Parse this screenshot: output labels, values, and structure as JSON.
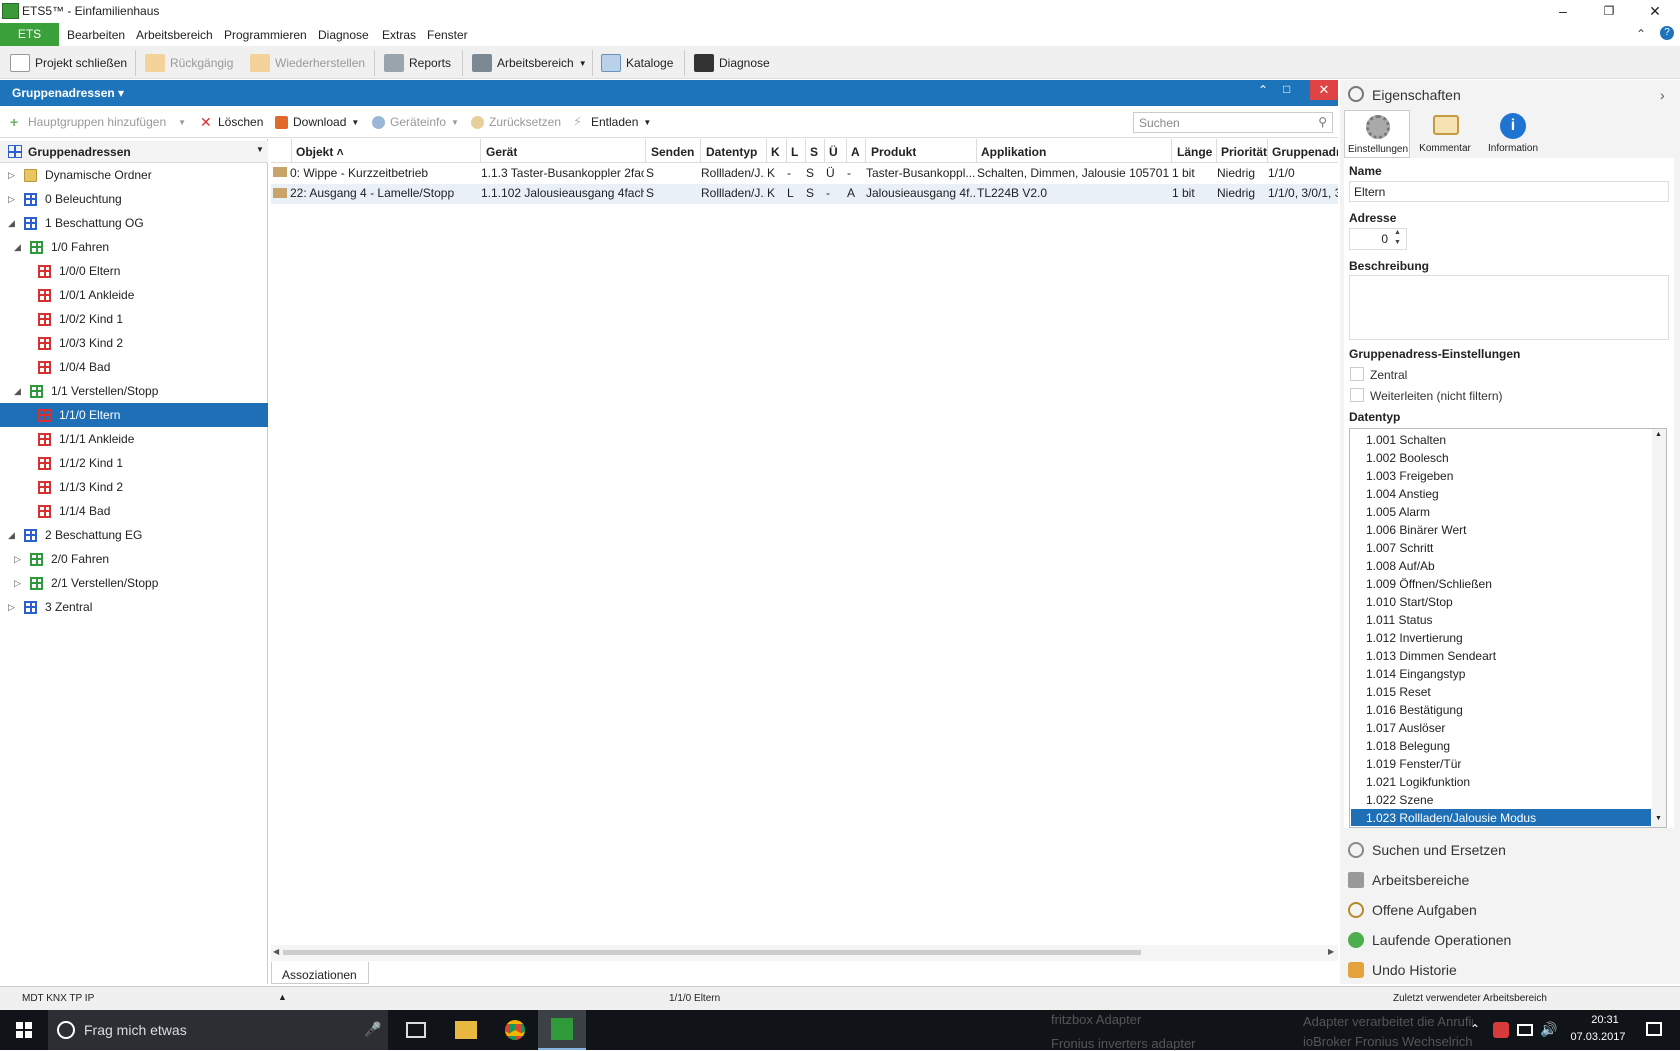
{
  "window": {
    "title": "ETS5™ - Einfamilienhaus"
  },
  "menu": {
    "ets": "ETS",
    "items": [
      "Bearbeiten",
      "Arbeitsbereich",
      "Programmieren",
      "Diagnose",
      "Extras",
      "Fenster"
    ]
  },
  "toolbar": {
    "close_project": "Projekt schließen",
    "undo": "Rückgängig",
    "redo": "Wiederherstellen",
    "reports": "Reports",
    "workspace": "Arbeitsbereich",
    "catalogs": "Kataloge",
    "diagnose": "Diagnose"
  },
  "panel": {
    "title": "Gruppenadressen"
  },
  "toolbar2": {
    "add_main": "Hauptgruppen hinzufügen",
    "delete": "Löschen",
    "download": "Download",
    "device_info": "Geräteinfo",
    "reset": "Zurücksetzen",
    "unload": "Entladen",
    "search_placeholder": "Suchen"
  },
  "tree": {
    "header": "Gruppenadressen",
    "items": [
      {
        "label": "Dynamische Ordner"
      },
      {
        "label": "0 Beleuchtung"
      },
      {
        "label": "1 Beschattung OG"
      },
      {
        "label": "1/0 Fahren"
      },
      {
        "label": "1/0/0 Eltern"
      },
      {
        "label": "1/0/1 Ankleide"
      },
      {
        "label": "1/0/2 Kind 1"
      },
      {
        "label": "1/0/3 Kind 2"
      },
      {
        "label": "1/0/4 Bad"
      },
      {
        "label": "1/1 Verstellen/Stopp"
      },
      {
        "label": "1/1/0 Eltern"
      },
      {
        "label": "1/1/1 Ankleide"
      },
      {
        "label": "1/1/2 Kind 1"
      },
      {
        "label": "1/1/3 Kind 2"
      },
      {
        "label": "1/1/4 Bad"
      },
      {
        "label": "2 Beschattung EG"
      },
      {
        "label": "2/0 Fahren"
      },
      {
        "label": "2/1 Verstellen/Stopp"
      },
      {
        "label": "3 Zentral"
      }
    ]
  },
  "grid": {
    "columns": [
      "Objekt",
      "Gerät",
      "Senden",
      "Datentyp",
      "K",
      "L",
      "S",
      "Ü",
      "A",
      "Produkt",
      "Applikation",
      "Länge",
      "Priorität",
      "Gruppenadr"
    ],
    "rows": [
      [
        "0: Wippe - Kurzzeitbetrieb",
        "1.1.3 Taster-Busankoppler 2fac...",
        "S",
        "Rollladen/J...",
        "K",
        "-",
        "S",
        "Ü",
        "-",
        "Taster-Busankoppl...",
        "Schalten, Dimmen, Jalousie 105701",
        "1 bit",
        "Niedrig",
        "1/1/0"
      ],
      [
        "22: Ausgang 4 - Lamelle/Stopp",
        "1.1.102 Jalousieausgang 4fach,...",
        "S",
        "Rollladen/J...",
        "K",
        "L",
        "S",
        "-",
        "A",
        "Jalousieausgang 4f...",
        "TL224B V2.0",
        "1 bit",
        "Niedrig",
        "1/1/0, 3/0/1, 3/"
      ]
    ]
  },
  "assoc_tab": "Assoziationen",
  "properties": {
    "title": "Eigenschaften",
    "tabs": [
      "Einstellungen",
      "Kommentar",
      "Information"
    ],
    "name_label": "Name",
    "name_value": "Eltern",
    "address_label": "Adresse",
    "address_value": "0",
    "description_label": "Beschreibung",
    "ga_settings_label": "Gruppenadress-Einstellungen",
    "central": "Zentral",
    "forward": "Weiterleiten (nicht filtern)",
    "datatype_label": "Datentyp",
    "datatypes": [
      "1.001 Schalten",
      "1.002 Boolesch",
      "1.003 Freigeben",
      "1.004 Anstieg",
      "1.005 Alarm",
      "1.006 Binärer Wert",
      "1.007 Schritt",
      "1.008 Auf/Ab",
      "1.009 Öffnen/Schließen",
      "1.010 Start/Stop",
      "1.011 Status",
      "1.012 Invertierung",
      "1.013 Dimmen Sendeart",
      "1.014 Eingangstyp",
      "1.015 Reset",
      "1.016 Bestätigung",
      "1.017 Auslöser",
      "1.018 Belegung",
      "1.019 Fenster/Tür",
      "1.021 Logikfunktion",
      "1.022 Szene",
      "1.023 Rollladen/Jalousie Modus"
    ],
    "links": [
      "Suchen und Ersetzen",
      "Arbeitsbereiche",
      "Offene Aufgaben",
      "Laufende Operationen",
      "Undo Historie"
    ]
  },
  "status": {
    "interface": "MDT KNX TP IP",
    "selection": "1/1/0 Eltern",
    "workspace": "Zuletzt verwendeter Arbeitsbereich"
  },
  "taskbar": {
    "search": "Frag mich etwas",
    "time": "20:31",
    "date": "07.03.2017",
    "bg1": "fritzbox Adapter",
    "bg2": "Fronius inverters adapter",
    "bg3": "Adapter verarbeitet die Anrufinformation der Fritzbox über",
    "bg4": "ioBroker Fronius Wechselrichter Adapter"
  }
}
